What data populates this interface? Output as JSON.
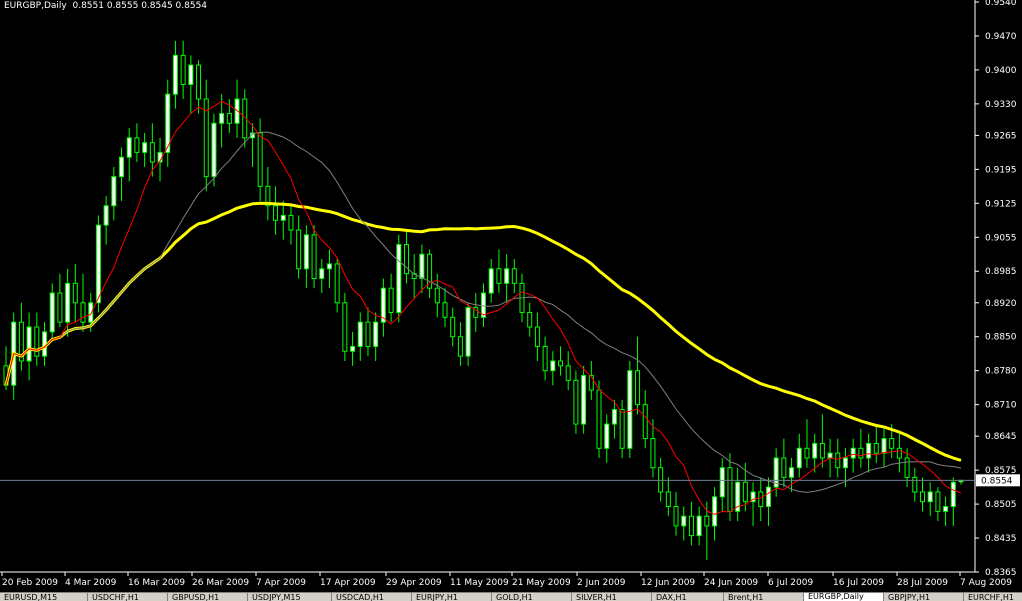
{
  "chart": {
    "symbol_label": "EURGBP,Daily",
    "ohlc_text": "0.8551 0.8555 0.8545 0.8554",
    "current_price_label": "0.8554",
    "colors": {
      "background": "#000000",
      "axis": "#ffffff",
      "candle_bull": "#ffffff",
      "candle_bear": "#000000",
      "candle_border": "#00ff00",
      "ma_fast": "#ff0000",
      "ma_mid": "#808080",
      "ma_slow": "#ffff00",
      "price_line": "#6f7f8f"
    }
  },
  "chart_data": {
    "type": "candlestick",
    "title": "EURGBP,Daily",
    "y_ticks": [
      "0.9540",
      "0.9470",
      "0.9400",
      "0.9330",
      "0.9265",
      "0.9195",
      "0.9125",
      "0.9055",
      "0.8985",
      "0.8920",
      "0.8850",
      "0.8780",
      "0.8710",
      "0.8645",
      "0.8575",
      "0.8505",
      "0.8435",
      "0.8365"
    ],
    "x_ticks": [
      "20 Feb 2009",
      "4 Mar 2009",
      "16 Mar 2009",
      "26 Mar 2009",
      "7 Apr 2009",
      "17 Apr 2009",
      "29 Apr 2009",
      "11 May 2009",
      "21 May 2009",
      "2 Jun 2009",
      "12 Jun 2009",
      "24 Jun 2009",
      "6 Jul 2009",
      "16 Jul 2009",
      "28 Jul 2009",
      "7 Aug 2009"
    ],
    "ylim": [
      0.8365,
      0.954
    ],
    "last_price": 0.8554,
    "candles": [
      {
        "o": 0.879,
        "h": 0.883,
        "l": 0.874,
        "c": 0.875
      },
      {
        "o": 0.875,
        "h": 0.89,
        "l": 0.872,
        "c": 0.888
      },
      {
        "o": 0.888,
        "h": 0.892,
        "l": 0.878,
        "c": 0.88
      },
      {
        "o": 0.88,
        "h": 0.89,
        "l": 0.876,
        "c": 0.887
      },
      {
        "o": 0.887,
        "h": 0.89,
        "l": 0.879,
        "c": 0.881
      },
      {
        "o": 0.881,
        "h": 0.888,
        "l": 0.879,
        "c": 0.886
      },
      {
        "o": 0.886,
        "h": 0.896,
        "l": 0.884,
        "c": 0.894
      },
      {
        "o": 0.894,
        "h": 0.898,
        "l": 0.887,
        "c": 0.888
      },
      {
        "o": 0.888,
        "h": 0.899,
        "l": 0.885,
        "c": 0.896
      },
      {
        "o": 0.896,
        "h": 0.9,
        "l": 0.888,
        "c": 0.892
      },
      {
        "o": 0.892,
        "h": 0.898,
        "l": 0.886,
        "c": 0.888
      },
      {
        "o": 0.888,
        "h": 0.894,
        "l": 0.886,
        "c": 0.892
      },
      {
        "o": 0.892,
        "h": 0.91,
        "l": 0.89,
        "c": 0.908
      },
      {
        "o": 0.908,
        "h": 0.914,
        "l": 0.904,
        "c": 0.912
      },
      {
        "o": 0.912,
        "h": 0.92,
        "l": 0.909,
        "c": 0.918
      },
      {
        "o": 0.918,
        "h": 0.924,
        "l": 0.913,
        "c": 0.922
      },
      {
        "o": 0.922,
        "h": 0.928,
        "l": 0.917,
        "c": 0.926
      },
      {
        "o": 0.926,
        "h": 0.929,
        "l": 0.921,
        "c": 0.923
      },
      {
        "o": 0.923,
        "h": 0.927,
        "l": 0.92,
        "c": 0.925
      },
      {
        "o": 0.925,
        "h": 0.929,
        "l": 0.918,
        "c": 0.921
      },
      {
        "o": 0.921,
        "h": 0.926,
        "l": 0.917,
        "c": 0.923
      },
      {
        "o": 0.923,
        "h": 0.938,
        "l": 0.92,
        "c": 0.935
      },
      {
        "o": 0.935,
        "h": 0.946,
        "l": 0.932,
        "c": 0.943
      },
      {
        "o": 0.943,
        "h": 0.946,
        "l": 0.934,
        "c": 0.937
      },
      {
        "o": 0.937,
        "h": 0.943,
        "l": 0.931,
        "c": 0.941
      },
      {
        "o": 0.941,
        "h": 0.942,
        "l": 0.931,
        "c": 0.934
      },
      {
        "o": 0.934,
        "h": 0.938,
        "l": 0.915,
        "c": 0.918
      },
      {
        "o": 0.918,
        "h": 0.931,
        "l": 0.916,
        "c": 0.929
      },
      {
        "o": 0.929,
        "h": 0.935,
        "l": 0.924,
        "c": 0.931
      },
      {
        "o": 0.931,
        "h": 0.934,
        "l": 0.927,
        "c": 0.929
      },
      {
        "o": 0.929,
        "h": 0.938,
        "l": 0.926,
        "c": 0.934
      },
      {
        "o": 0.934,
        "h": 0.936,
        "l": 0.924,
        "c": 0.926
      },
      {
        "o": 0.926,
        "h": 0.929,
        "l": 0.92,
        "c": 0.927
      },
      {
        "o": 0.927,
        "h": 0.93,
        "l": 0.913,
        "c": 0.916
      },
      {
        "o": 0.916,
        "h": 0.92,
        "l": 0.909,
        "c": 0.912
      },
      {
        "o": 0.912,
        "h": 0.916,
        "l": 0.906,
        "c": 0.909
      },
      {
        "o": 0.909,
        "h": 0.913,
        "l": 0.905,
        "c": 0.91
      },
      {
        "o": 0.91,
        "h": 0.912,
        "l": 0.904,
        "c": 0.907
      },
      {
        "o": 0.907,
        "h": 0.91,
        "l": 0.897,
        "c": 0.899
      },
      {
        "o": 0.899,
        "h": 0.908,
        "l": 0.895,
        "c": 0.906
      },
      {
        "o": 0.906,
        "h": 0.908,
        "l": 0.895,
        "c": 0.897
      },
      {
        "o": 0.897,
        "h": 0.901,
        "l": 0.894,
        "c": 0.899
      },
      {
        "o": 0.899,
        "h": 0.903,
        "l": 0.895,
        "c": 0.9
      },
      {
        "o": 0.9,
        "h": 0.901,
        "l": 0.89,
        "c": 0.892
      },
      {
        "o": 0.892,
        "h": 0.894,
        "l": 0.88,
        "c": 0.882
      },
      {
        "o": 0.882,
        "h": 0.886,
        "l": 0.879,
        "c": 0.883
      },
      {
        "o": 0.883,
        "h": 0.89,
        "l": 0.88,
        "c": 0.888
      },
      {
        "o": 0.888,
        "h": 0.891,
        "l": 0.881,
        "c": 0.883
      },
      {
        "o": 0.883,
        "h": 0.89,
        "l": 0.88,
        "c": 0.888
      },
      {
        "o": 0.888,
        "h": 0.897,
        "l": 0.885,
        "c": 0.895
      },
      {
        "o": 0.895,
        "h": 0.898,
        "l": 0.888,
        "c": 0.89
      },
      {
        "o": 0.89,
        "h": 0.906,
        "l": 0.888,
        "c": 0.904
      },
      {
        "o": 0.904,
        "h": 0.907,
        "l": 0.896,
        "c": 0.898
      },
      {
        "o": 0.898,
        "h": 0.902,
        "l": 0.893,
        "c": 0.897
      },
      {
        "o": 0.897,
        "h": 0.904,
        "l": 0.894,
        "c": 0.902
      },
      {
        "o": 0.902,
        "h": 0.903,
        "l": 0.893,
        "c": 0.895
      },
      {
        "o": 0.895,
        "h": 0.898,
        "l": 0.889,
        "c": 0.892
      },
      {
        "o": 0.892,
        "h": 0.895,
        "l": 0.887,
        "c": 0.889
      },
      {
        "o": 0.889,
        "h": 0.891,
        "l": 0.883,
        "c": 0.885
      },
      {
        "o": 0.885,
        "h": 0.888,
        "l": 0.879,
        "c": 0.881
      },
      {
        "o": 0.881,
        "h": 0.892,
        "l": 0.879,
        "c": 0.891
      },
      {
        "o": 0.891,
        "h": 0.894,
        "l": 0.886,
        "c": 0.889
      },
      {
        "o": 0.889,
        "h": 0.896,
        "l": 0.887,
        "c": 0.894
      },
      {
        "o": 0.894,
        "h": 0.901,
        "l": 0.892,
        "c": 0.899
      },
      {
        "o": 0.899,
        "h": 0.903,
        "l": 0.894,
        "c": 0.896
      },
      {
        "o": 0.896,
        "h": 0.902,
        "l": 0.892,
        "c": 0.899
      },
      {
        "o": 0.899,
        "h": 0.901,
        "l": 0.894,
        "c": 0.896
      },
      {
        "o": 0.896,
        "h": 0.898,
        "l": 0.888,
        "c": 0.89
      },
      {
        "o": 0.89,
        "h": 0.892,
        "l": 0.885,
        "c": 0.887
      },
      {
        "o": 0.887,
        "h": 0.89,
        "l": 0.88,
        "c": 0.883
      },
      {
        "o": 0.883,
        "h": 0.885,
        "l": 0.876,
        "c": 0.878
      },
      {
        "o": 0.878,
        "h": 0.882,
        "l": 0.875,
        "c": 0.88
      },
      {
        "o": 0.88,
        "h": 0.883,
        "l": 0.877,
        "c": 0.879
      },
      {
        "o": 0.879,
        "h": 0.882,
        "l": 0.874,
        "c": 0.876
      },
      {
        "o": 0.876,
        "h": 0.878,
        "l": 0.865,
        "c": 0.867
      },
      {
        "o": 0.867,
        "h": 0.879,
        "l": 0.865,
        "c": 0.877
      },
      {
        "o": 0.877,
        "h": 0.88,
        "l": 0.872,
        "c": 0.874
      },
      {
        "o": 0.874,
        "h": 0.876,
        "l": 0.86,
        "c": 0.862
      },
      {
        "o": 0.862,
        "h": 0.869,
        "l": 0.859,
        "c": 0.867
      },
      {
        "o": 0.867,
        "h": 0.872,
        "l": 0.864,
        "c": 0.87
      },
      {
        "o": 0.87,
        "h": 0.872,
        "l": 0.86,
        "c": 0.862
      },
      {
        "o": 0.862,
        "h": 0.88,
        "l": 0.86,
        "c": 0.878
      },
      {
        "o": 0.878,
        "h": 0.885,
        "l": 0.869,
        "c": 0.871
      },
      {
        "o": 0.871,
        "h": 0.874,
        "l": 0.862,
        "c": 0.864
      },
      {
        "o": 0.864,
        "h": 0.868,
        "l": 0.856,
        "c": 0.858
      },
      {
        "o": 0.858,
        "h": 0.86,
        "l": 0.851,
        "c": 0.853
      },
      {
        "o": 0.853,
        "h": 0.856,
        "l": 0.848,
        "c": 0.85
      },
      {
        "o": 0.85,
        "h": 0.853,
        "l": 0.844,
        "c": 0.846
      },
      {
        "o": 0.846,
        "h": 0.85,
        "l": 0.843,
        "c": 0.848
      },
      {
        "o": 0.848,
        "h": 0.851,
        "l": 0.842,
        "c": 0.844
      },
      {
        "o": 0.844,
        "h": 0.85,
        "l": 0.842,
        "c": 0.848
      },
      {
        "o": 0.848,
        "h": 0.851,
        "l": 0.839,
        "c": 0.846
      },
      {
        "o": 0.846,
        "h": 0.854,
        "l": 0.843,
        "c": 0.852
      },
      {
        "o": 0.852,
        "h": 0.86,
        "l": 0.849,
        "c": 0.858
      },
      {
        "o": 0.858,
        "h": 0.861,
        "l": 0.847,
        "c": 0.849
      },
      {
        "o": 0.849,
        "h": 0.858,
        "l": 0.847,
        "c": 0.855
      },
      {
        "o": 0.855,
        "h": 0.859,
        "l": 0.849,
        "c": 0.851
      },
      {
        "o": 0.851,
        "h": 0.855,
        "l": 0.846,
        "c": 0.853
      },
      {
        "o": 0.853,
        "h": 0.856,
        "l": 0.847,
        "c": 0.85
      },
      {
        "o": 0.85,
        "h": 0.856,
        "l": 0.846,
        "c": 0.854
      },
      {
        "o": 0.854,
        "h": 0.862,
        "l": 0.852,
        "c": 0.86
      },
      {
        "o": 0.86,
        "h": 0.864,
        "l": 0.854,
        "c": 0.856
      },
      {
        "o": 0.856,
        "h": 0.86,
        "l": 0.853,
        "c": 0.858
      },
      {
        "o": 0.858,
        "h": 0.865,
        "l": 0.856,
        "c": 0.862
      },
      {
        "o": 0.862,
        "h": 0.868,
        "l": 0.858,
        "c": 0.86
      },
      {
        "o": 0.86,
        "h": 0.865,
        "l": 0.857,
        "c": 0.863
      },
      {
        "o": 0.863,
        "h": 0.869,
        "l": 0.858,
        "c": 0.86
      },
      {
        "o": 0.86,
        "h": 0.864,
        "l": 0.856,
        "c": 0.861
      },
      {
        "o": 0.861,
        "h": 0.864,
        "l": 0.856,
        "c": 0.858
      },
      {
        "o": 0.858,
        "h": 0.862,
        "l": 0.854,
        "c": 0.86
      },
      {
        "o": 0.86,
        "h": 0.864,
        "l": 0.857,
        "c": 0.862
      },
      {
        "o": 0.862,
        "h": 0.866,
        "l": 0.858,
        "c": 0.86
      },
      {
        "o": 0.86,
        "h": 0.865,
        "l": 0.857,
        "c": 0.863
      },
      {
        "o": 0.863,
        "h": 0.867,
        "l": 0.859,
        "c": 0.861
      },
      {
        "o": 0.861,
        "h": 0.866,
        "l": 0.858,
        "c": 0.864
      },
      {
        "o": 0.864,
        "h": 0.867,
        "l": 0.86,
        "c": 0.862
      },
      {
        "o": 0.862,
        "h": 0.865,
        "l": 0.857,
        "c": 0.86
      },
      {
        "o": 0.86,
        "h": 0.862,
        "l": 0.854,
        "c": 0.856
      },
      {
        "o": 0.856,
        "h": 0.858,
        "l": 0.851,
        "c": 0.853
      },
      {
        "o": 0.853,
        "h": 0.856,
        "l": 0.849,
        "c": 0.851
      },
      {
        "o": 0.851,
        "h": 0.855,
        "l": 0.848,
        "c": 0.853
      },
      {
        "o": 0.853,
        "h": 0.854,
        "l": 0.847,
        "c": 0.849
      },
      {
        "o": 0.849,
        "h": 0.852,
        "l": 0.846,
        "c": 0.85
      },
      {
        "o": 0.85,
        "h": 0.856,
        "l": 0.846,
        "c": 0.855
      },
      {
        "o": 0.8551,
        "h": 0.8555,
        "l": 0.8545,
        "c": 0.8554
      }
    ]
  },
  "tabs": [
    {
      "label": "EURUSD,M15",
      "active": false
    },
    {
      "label": "USDCHF,H1",
      "active": false
    },
    {
      "label": "GBPUSD,H1",
      "active": false
    },
    {
      "label": "USDJPY,M15",
      "active": false
    },
    {
      "label": "USDCAD,H1",
      "active": false
    },
    {
      "label": "EURJPY,H1",
      "active": false
    },
    {
      "label": "GOLD,H1",
      "active": false
    },
    {
      "label": "SILVER,H1",
      "active": false
    },
    {
      "label": "DAX,H1",
      "active": false
    },
    {
      "label": "Brent,H1",
      "active": false
    },
    {
      "label": "EURGBP,Daily",
      "active": true
    },
    {
      "label": "GBPJPY,H1",
      "active": false
    },
    {
      "label": "EURCHF,H1",
      "active": false
    }
  ]
}
